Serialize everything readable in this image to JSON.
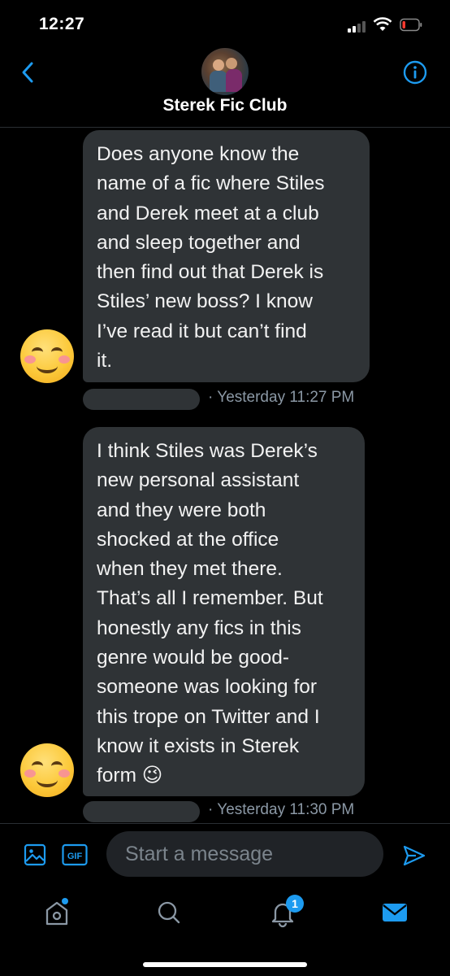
{
  "status_bar": {
    "time": "12:27"
  },
  "header": {
    "title": "Sterek Fic Club"
  },
  "messages": [
    {
      "text": "Does anyone know the\nname of a fic where Stiles\nand Derek meet at a club\nand sleep together and\nthen find out that Derek is\nStiles’ new boss? I know\nI’ve read it but can’t find\nit.",
      "timestamp": "· Yesterday 11:27 PM"
    },
    {
      "text": "I think Stiles was Derek’s\nnew personal assistant\nand they were both\nshocked at the office\nwhen they met there.\nThat’s all I remember. But\nhonestly any fics in this\ngenre would be good-\nsomeone was looking for\nthis trope on Twitter and I\nknow it exists in Sterek\nform 😉",
      "timestamp": "· Yesterday 11:30 PM"
    }
  ],
  "compose": {
    "placeholder": "Start a message",
    "gif_label": "GIF"
  },
  "tabbar": {
    "notifications_count": "1"
  },
  "colors": {
    "accent": "#1d9bf0",
    "bubble": "#2f3336",
    "background": "#000000",
    "muted": "#8b98a5"
  }
}
